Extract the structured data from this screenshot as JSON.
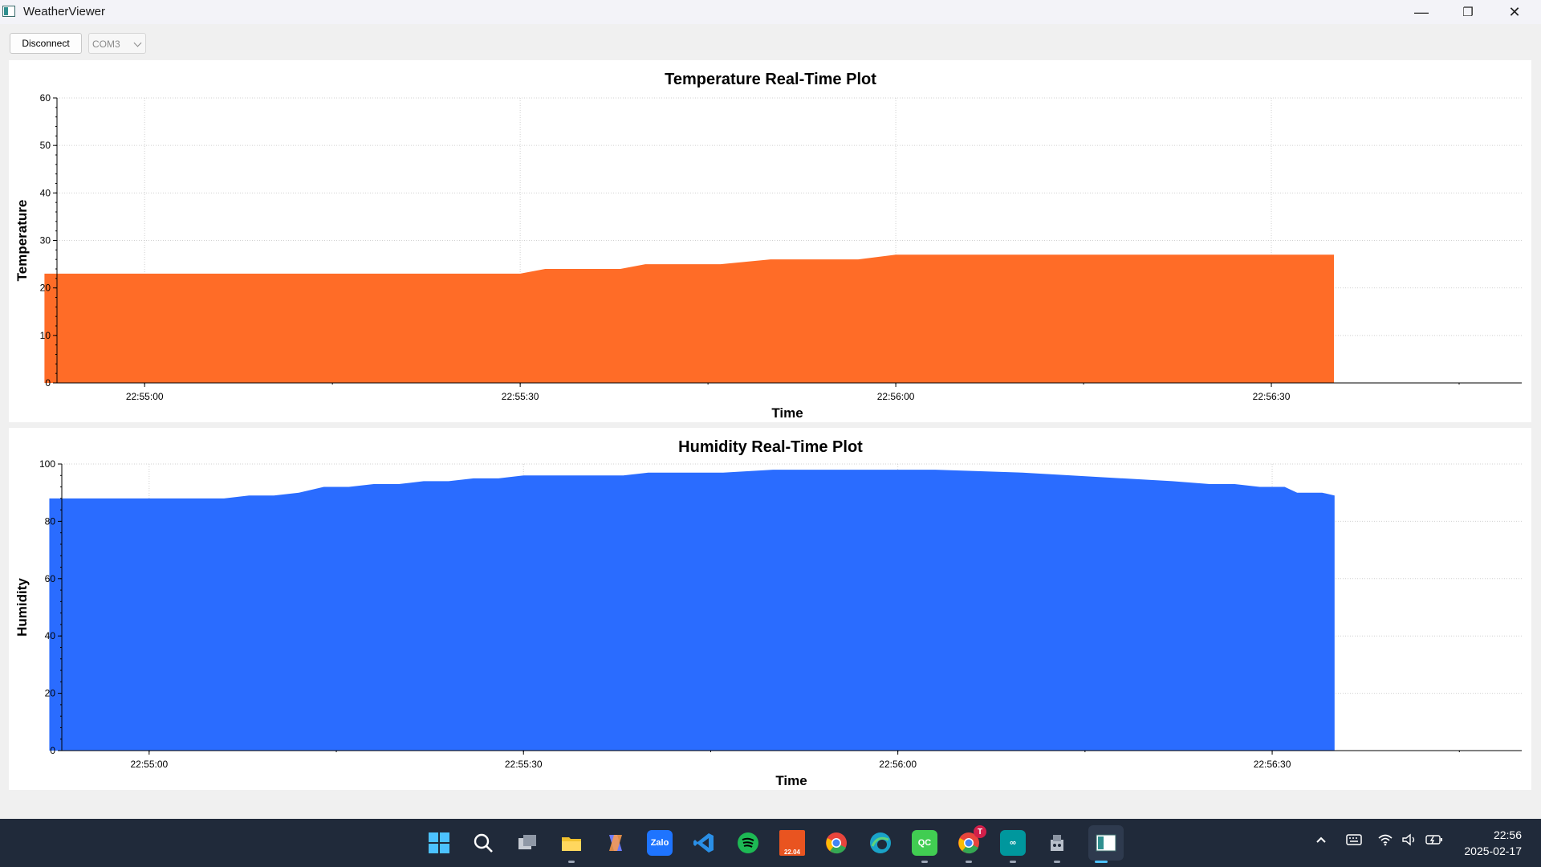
{
  "window": {
    "title": "WeatherViewer",
    "minimize": "—",
    "restore": "❐",
    "close": "✕"
  },
  "toolbar": {
    "disconnect_label": "Disconnect",
    "port_value": "COM3"
  },
  "charts": [
    {
      "id": "temperature",
      "type": "area",
      "title": "Temperature Real-Time Plot",
      "xlabel": "Time",
      "ylabel": "Temperature",
      "fill": "#ff6c27",
      "ylim": [
        0,
        60
      ],
      "yticks": [
        0,
        10,
        20,
        30,
        40,
        50,
        60
      ],
      "xlim": [
        "22:54:53",
        "22:56:50"
      ],
      "xticks": [
        "22:55:00",
        "22:55:30",
        "22:56:00",
        "22:56:30"
      ],
      "grid": true,
      "points": [
        [
          "22:54:52",
          23
        ],
        [
          "22:55:30",
          23
        ],
        [
          "22:55:32",
          24
        ],
        [
          "22:55:38",
          24
        ],
        [
          "22:55:40",
          25
        ],
        [
          "22:55:46",
          25
        ],
        [
          "22:55:50",
          26
        ],
        [
          "22:55:57",
          26
        ],
        [
          "22:56:00",
          27
        ],
        [
          "22:56:35",
          27
        ]
      ]
    },
    {
      "id": "humidity",
      "type": "area",
      "title": "Humidity Real-Time Plot",
      "xlabel": "Time",
      "ylabel": "Humidity",
      "fill": "#2a6cff",
      "ylim": [
        0,
        100
      ],
      "yticks": [
        0,
        20,
        40,
        60,
        80,
        100
      ],
      "xlim": [
        "22:54:53",
        "22:56:50"
      ],
      "xticks": [
        "22:55:00",
        "22:55:30",
        "22:56:00",
        "22:56:30"
      ],
      "grid": true,
      "points": [
        [
          "22:54:52",
          88
        ],
        [
          "22:55:06",
          88
        ],
        [
          "22:55:08",
          89
        ],
        [
          "22:55:10",
          89
        ],
        [
          "22:55:12",
          90
        ],
        [
          "22:55:14",
          92
        ],
        [
          "22:55:16",
          92
        ],
        [
          "22:55:18",
          93
        ],
        [
          "22:55:20",
          93
        ],
        [
          "22:55:22",
          94
        ],
        [
          "22:55:24",
          94
        ],
        [
          "22:55:26",
          95
        ],
        [
          "22:55:28",
          95
        ],
        [
          "22:55:30",
          96
        ],
        [
          "22:55:38",
          96
        ],
        [
          "22:55:40",
          97
        ],
        [
          "22:55:46",
          97
        ],
        [
          "22:55:50",
          98
        ],
        [
          "22:56:03",
          98
        ],
        [
          "22:56:10",
          97
        ],
        [
          "22:56:22",
          94
        ],
        [
          "22:56:25",
          93
        ],
        [
          "22:56:27",
          93
        ],
        [
          "22:56:29",
          92
        ],
        [
          "22:56:31",
          92
        ],
        [
          "22:56:32",
          90
        ],
        [
          "22:56:34",
          90
        ],
        [
          "22:56:35",
          89
        ]
      ]
    }
  ],
  "taskbar": {
    "apps": [
      {
        "name": "start-icon",
        "color": "#3aa0ff"
      },
      {
        "name": "search-icon",
        "color": "#202a3a"
      },
      {
        "name": "task-view-icon",
        "color": "#8892a2"
      },
      {
        "name": "file-explorer-icon",
        "color": "#f2c12e"
      },
      {
        "name": "copilot-icon",
        "color": "#6d7cff"
      },
      {
        "name": "zalo-icon",
        "color": "#1e74ff",
        "text": "Zalo"
      },
      {
        "name": "vscode-icon",
        "color": "#2a8fe6"
      },
      {
        "name": "spotify-icon",
        "color": "#1db954"
      },
      {
        "name": "ubuntu-icon",
        "color": "#e95420",
        "text": "22.04"
      },
      {
        "name": "chrome-icon",
        "color": "#e8453c"
      },
      {
        "name": "edge-icon",
        "color": "#1aa3c8"
      },
      {
        "name": "qt-creator-icon",
        "color": "#41cd52",
        "text": "QC"
      },
      {
        "name": "chrome-profile-icon",
        "color": "#e8453c"
      },
      {
        "name": "arduino-icon",
        "color": "#00979d",
        "text": "∞"
      },
      {
        "name": "ros-icon",
        "color": "#9aa4b4"
      },
      {
        "name": "weatherviewer-taskbar-icon",
        "color": "#dfe7ef"
      }
    ],
    "chrome_badge": "T",
    "ubuntu_label": "22.04",
    "clock_time": "22:56",
    "clock_date": "2025-02-17"
  }
}
